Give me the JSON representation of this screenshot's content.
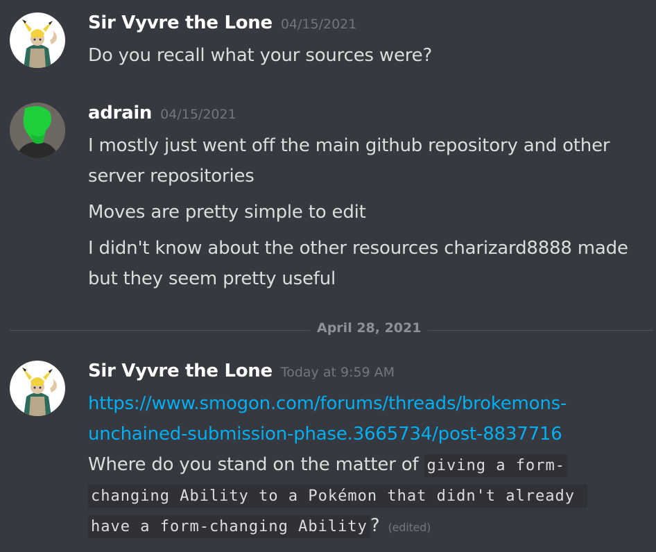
{
  "messages": [
    {
      "author": "Sir Vyvre the Lone",
      "timestamp": "04/15/2021",
      "avatar": "pikachu-costume-icon",
      "lines": [
        "Do you recall what your sources were?"
      ]
    },
    {
      "author": "adrain",
      "timestamp": "04/15/2021",
      "avatar": "green-silhouette-icon",
      "lines": [
        "I mostly just went off the main github repository and other",
        "server repositories",
        "Moves are pretty simple to edit",
        "I didn't know about the other resources charizard8888 made",
        "but they seem pretty useful"
      ]
    },
    {
      "author": "Sir Vyvre the Lone",
      "timestamp": "Today at 9:59 AM",
      "avatar": "pikachu-costume-icon",
      "link_line1": "https://www.smogon.com/forums/threads/brokemons-",
      "link_line2": "unchained-submission-phase.3665734/post-8837716",
      "text_prefix": "Where do you stand on the matter of ",
      "code_line1": "giving a form-",
      "code_line2": "changing Ability to a Pokémon that didn't already ",
      "code_line3": "have a form-changing Ability",
      "text_suffix": "?",
      "edited": "(edited)"
    }
  ],
  "divider": {
    "label": "April 28, 2021"
  },
  "colors": {
    "background": "#36393f",
    "username": "#ffffff",
    "timestamp": "#72767d",
    "text": "#dcddde",
    "link": "#00aff4",
    "code_bg": "#2f3136",
    "divider_line": "#4f545c"
  }
}
